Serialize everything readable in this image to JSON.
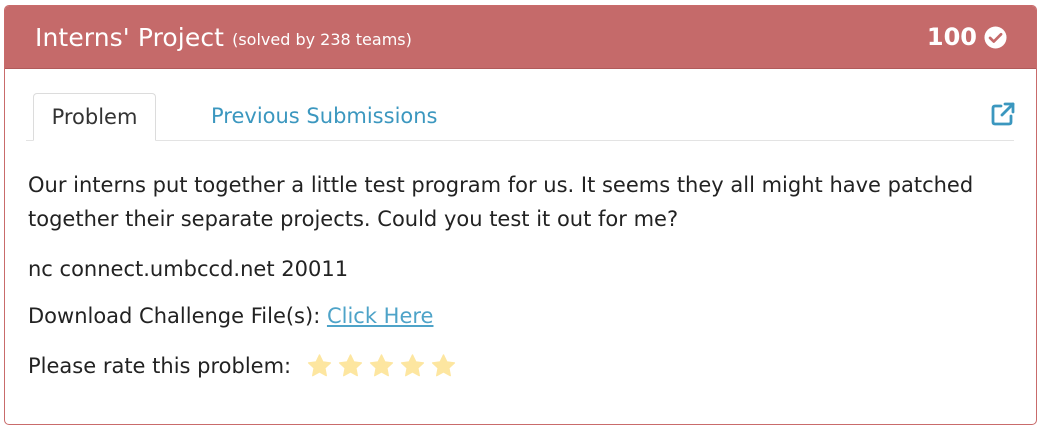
{
  "header": {
    "title": "Interns' Project",
    "subtitle": "(solved by 238 teams)",
    "score": "100",
    "accent_color": "#c56a6a"
  },
  "tabs": {
    "problem_label": "Problem",
    "submissions_label": "Previous Submissions",
    "external_icon": "external-link-icon"
  },
  "problem": {
    "description": "Our interns put together a little test program for us. It seems they all might have patched together their separate projects. Could you test it out for me?",
    "connection": "nc connect.umbccd.net 20011",
    "download_label": "Download Challenge File(s): ",
    "download_link": "Click Here",
    "rate_label": "Please rate this problem:",
    "star_count": 5,
    "star_color": "#fde6a0"
  }
}
